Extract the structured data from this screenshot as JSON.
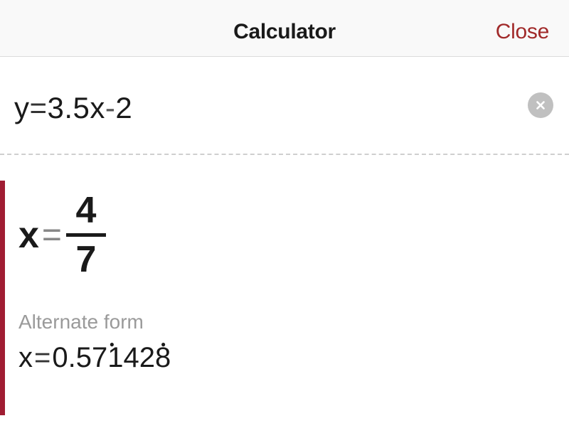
{
  "header": {
    "title": "Calculator",
    "close_label": "Close"
  },
  "input": {
    "expression_y": "y",
    "expression_eq": "=",
    "expression_coef": "3.5x",
    "expression_minus": "-",
    "expression_const": "2"
  },
  "result": {
    "variable": "x",
    "equals": "=",
    "numerator": "4",
    "denominator": "7"
  },
  "alternate": {
    "label": "Alternate form",
    "prefix_var": "x",
    "equals": "=",
    "leading": "0.",
    "digits": "571428"
  }
}
